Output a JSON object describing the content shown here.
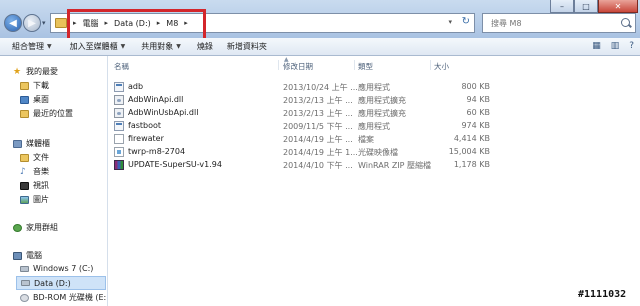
{
  "window": {
    "controls": [
      "–",
      "□",
      "✕"
    ]
  },
  "address": {
    "breadcrumbs": [
      "電腦",
      "Data (D:)",
      "M8"
    ],
    "highlight_color": "#d3262b"
  },
  "search": {
    "placeholder": "搜尋 M8"
  },
  "commands": [
    "組合管理",
    "加入至媒體櫃",
    "共用對象",
    "燒錄",
    "新增資料夾"
  ],
  "nav": {
    "favorites": {
      "label": "我的最愛",
      "items": [
        "下載",
        "桌面",
        "最近的位置"
      ]
    },
    "libraries": {
      "label": "媒體櫃",
      "items": [
        "文件",
        "音樂",
        "視訊",
        "圖片"
      ]
    },
    "homegroup": {
      "label": "家用群組"
    },
    "computer": {
      "label": "電腦",
      "items": [
        "Windows 7 (C:)",
        "Data (D:)",
        "BD-ROM 光碟機 (E:"
      ]
    },
    "selected": "Data (D:)"
  },
  "columns": {
    "name": "名稱",
    "date": "修改日期",
    "type": "類型",
    "size": "大小"
  },
  "files": [
    {
      "name": "adb",
      "date": "2013/10/24 上午 ...",
      "type": "應用程式",
      "size": "800 KB",
      "icon": "exe"
    },
    {
      "name": "AdbWinApi.dll",
      "date": "2013/2/13 上午 ...",
      "type": "應用程式擴充",
      "size": "94 KB",
      "icon": "dll"
    },
    {
      "name": "AdbWinUsbApi.dll",
      "date": "2013/2/13 上午 ...",
      "type": "應用程式擴充",
      "size": "60 KB",
      "icon": "dll"
    },
    {
      "name": "fastboot",
      "date": "2009/11/5 下午 ...",
      "type": "應用程式",
      "size": "974 KB",
      "icon": "exe"
    },
    {
      "name": "firewater",
      "date": "2014/4/19 上午 ...",
      "type": "檔案",
      "size": "4,414 KB",
      "icon": "doc"
    },
    {
      "name": "twrp-m8-2704",
      "date": "2014/4/19 上午 1...",
      "type": "光碟映像檔",
      "size": "15,004 KB",
      "icon": "img"
    },
    {
      "name": "UPDATE-SuperSU-v1.94",
      "date": "2014/4/10 下午 ...",
      "type": "WinRAR ZIP 壓縮檔",
      "size": "1,178 KB",
      "icon": "rar"
    }
  ],
  "watermark": "#1111032"
}
